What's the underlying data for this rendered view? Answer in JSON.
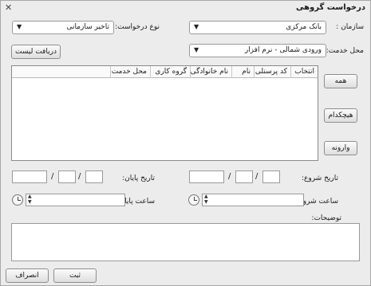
{
  "window": {
    "title": "درخواست گروهی",
    "close_glyph": "✕"
  },
  "form": {
    "org_label": "سازمان :",
    "org_value": "بانک مرکزی",
    "request_type_label": "نوع درخواست:",
    "request_type_value": "تاخیر سازمانی",
    "service_place_label": "محل خدمت:",
    "service_place_value": "ورودی شمالی - نرم افزار",
    "get_list_button": "دریافت لیست"
  },
  "grid": {
    "columns": [
      "انتخاب",
      "کد پرسنلی",
      "نام",
      "نام خانوادگی",
      "گروه کاری",
      "محل خدمت"
    ]
  },
  "side_buttons": {
    "all": "همه",
    "none": "هیچکدام",
    "invert": "وارونه"
  },
  "dates": {
    "start_label": "تاریخ شروع:",
    "end_label": "تاریخ پایان:",
    "separator": "/"
  },
  "times": {
    "start_label": "ساعت شروع:",
    "end_label": "ساعت پایان:"
  },
  "notes": {
    "label": "توضیحات:"
  },
  "actions": {
    "submit": "ثبت",
    "cancel": "انصراف"
  }
}
